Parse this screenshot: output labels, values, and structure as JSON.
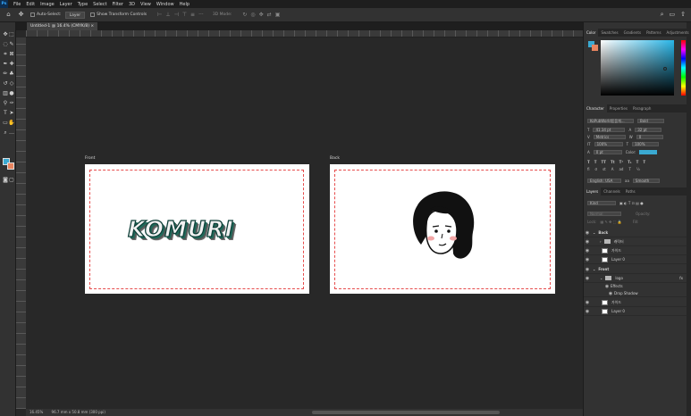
{
  "app": {
    "logo": "Ps"
  },
  "menu": [
    "File",
    "Edit",
    "Image",
    "Layer",
    "Type",
    "Select",
    "Filter",
    "3D",
    "View",
    "Window",
    "Help"
  ],
  "options": {
    "auto_select": "Auto-Select:",
    "layer_select": "Layer",
    "transform": "Show Transform Controls",
    "mode3d": "3D Mode:"
  },
  "document": {
    "tab_title": "Untitled-1 @ 16.4% (CMYK/8) ×"
  },
  "artboards": {
    "front_label": "Front",
    "back_label": "Back",
    "front_text": "KOMURI"
  },
  "status": {
    "zoom": "16.45%",
    "size": "96.7 mm x 50.8 mm (300 ppi)"
  },
  "color_panel": {
    "tabs": [
      "Color",
      "Swatches",
      "Gradients",
      "Patterns",
      "Adjustments"
    ],
    "fg": "#3aa9d1",
    "bg": "#e8845f"
  },
  "character_panel": {
    "tabs": [
      "Character",
      "Properties",
      "Paragraph"
    ],
    "font": "KoPubWorld돋움체...",
    "weight": "Bold",
    "size": "41.34 pt",
    "leading": "32 pt",
    "kerning": "Metrics",
    "tracking": "0",
    "vscale": "100%",
    "hscale": "100%",
    "baseline": "0 pt",
    "color_label": "Color:",
    "language": "English: USA",
    "aa": "Smooth"
  },
  "layers_panel": {
    "tabs": [
      "Layers",
      "Channels",
      "Paths"
    ],
    "kind": "Kind",
    "blend": "Normal",
    "opacity": "Opacity:",
    "lock": "Lock:",
    "fill": "Fill:",
    "items": [
      {
        "name": "Back",
        "type": "artboard"
      },
      {
        "name": "캐릭터",
        "type": "folder"
      },
      {
        "name": "가이드",
        "type": "layer"
      },
      {
        "name": "Layer 0",
        "type": "layer"
      },
      {
        "name": "Front",
        "type": "artboard"
      },
      {
        "name": "logo",
        "type": "folder"
      },
      {
        "name": "Effects",
        "type": "effect"
      },
      {
        "name": "Drop Shadow",
        "type": "effect"
      },
      {
        "name": "가이드",
        "type": "layer"
      },
      {
        "name": "Layer 0",
        "type": "layer"
      }
    ]
  }
}
